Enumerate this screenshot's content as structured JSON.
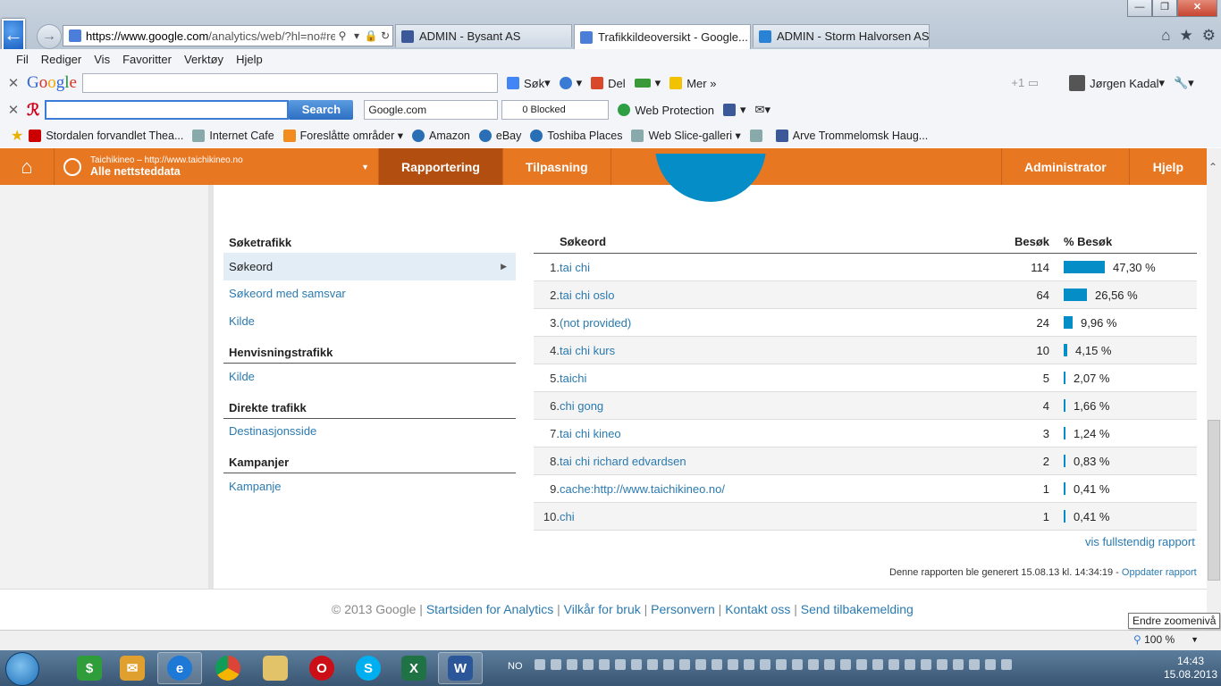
{
  "browser": {
    "url_host": "https://www.google.com",
    "url_rest": "/analytics/web/?hl=no#re",
    "tabs": [
      {
        "title": "ADMIN - Bysant AS",
        "color": "#3b5998"
      },
      {
        "title": "Trafikkildeoversikt - Google...",
        "color": "#4a7ed8",
        "active": true
      },
      {
        "title": "ADMIN - Storm Halvorsen AS",
        "color": "#2a82d4"
      }
    ],
    "close_glyph": "✕",
    "menu": [
      "Fil",
      "Rediger",
      "Vis",
      "Favoritter",
      "Verktøy",
      "Hjelp"
    ]
  },
  "google_toolbar": {
    "search_label": "Søk",
    "share_label": "Del",
    "more_label": "Mer",
    "user_name": "Jørgen Kadal"
  },
  "avira_toolbar": {
    "search_button": "Search",
    "engine": "Google.com",
    "blocked": "0 Blocked",
    "web_protection": "Web Protection"
  },
  "favorites": [
    "Stordalen forvandlet Thea...",
    "Internet Cafe",
    "Foreslåtte områder",
    "Amazon",
    "eBay",
    "Toshiba Places",
    "Web Slice-galleri",
    "Arve Trommelomsk Haug..."
  ],
  "ga_header": {
    "account_url": "Taichikineo – http://www.taichikineo.no",
    "account_view": "Alle nettsteddata",
    "nav": [
      "Rapportering",
      "Tilpasning"
    ],
    "right_nav": [
      "Administrator",
      "Hjelp"
    ]
  },
  "left_nav": {
    "search_title": "Søketrafikk",
    "search_selected": "Søkeord",
    "search_items": [
      "Søkeord med samsvar",
      "Kilde"
    ],
    "referral_title": "Henvisningstrafikk",
    "referral_items": [
      "Kilde"
    ],
    "direct_title": "Direkte trafikk",
    "direct_items": [
      "Destinasjonsside"
    ],
    "campaign_title": "Kampanjer",
    "campaign_items": [
      "Kampanje"
    ]
  },
  "table": {
    "headers": {
      "keyword": "Søkeord",
      "visits": "Besøk",
      "pct": "% Besøk"
    },
    "rows": [
      {
        "n": "1.",
        "keyword": "tai chi",
        "visits": "114",
        "pct": "47,30 %",
        "share": 47.3
      },
      {
        "n": "2.",
        "keyword": "tai chi oslo",
        "visits": "64",
        "pct": "26,56 %",
        "share": 26.56
      },
      {
        "n": "3.",
        "keyword": "(not provided)",
        "visits": "24",
        "pct": "9,96 %",
        "share": 9.96
      },
      {
        "n": "4.",
        "keyword": "tai chi kurs",
        "visits": "10",
        "pct": "4,15 %",
        "share": 4.15
      },
      {
        "n": "5.",
        "keyword": "taichi",
        "visits": "5",
        "pct": "2,07 %",
        "share": 2.07
      },
      {
        "n": "6.",
        "keyword": "chi gong",
        "visits": "4",
        "pct": "1,66 %",
        "share": 1.66
      },
      {
        "n": "7.",
        "keyword": "tai chi kineo",
        "visits": "3",
        "pct": "1,24 %",
        "share": 1.24
      },
      {
        "n": "8.",
        "keyword": "tai chi richard edvardsen",
        "visits": "2",
        "pct": "0,83 %",
        "share": 0.83
      },
      {
        "n": "9.",
        "keyword": "cache:http://www.taichikineo.no/",
        "visits": "1",
        "pct": "0,41 %",
        "share": 0.41
      },
      {
        "n": "10.",
        "keyword": "chi",
        "visits": "1",
        "pct": "0,41 %",
        "share": 0.41
      }
    ],
    "full_report": "vis fullstendig rapport",
    "generated": "Denne rapporten ble generert 15.08.13 kl. 14:34:19 - ",
    "refresh": "Oppdater rapport"
  },
  "footer": {
    "copyright": "© 2013 Google",
    "links": [
      "Startsiden for Analytics",
      "Vilkår for bruk",
      "Personvern",
      "Kontakt oss",
      "Send tilbakemelding"
    ]
  },
  "status": {
    "tooltip": "Endre zoomenivå",
    "zoom": "100 %"
  },
  "taskbar": {
    "lang": "NO",
    "time": "14:43",
    "date": "15.08.2013"
  }
}
